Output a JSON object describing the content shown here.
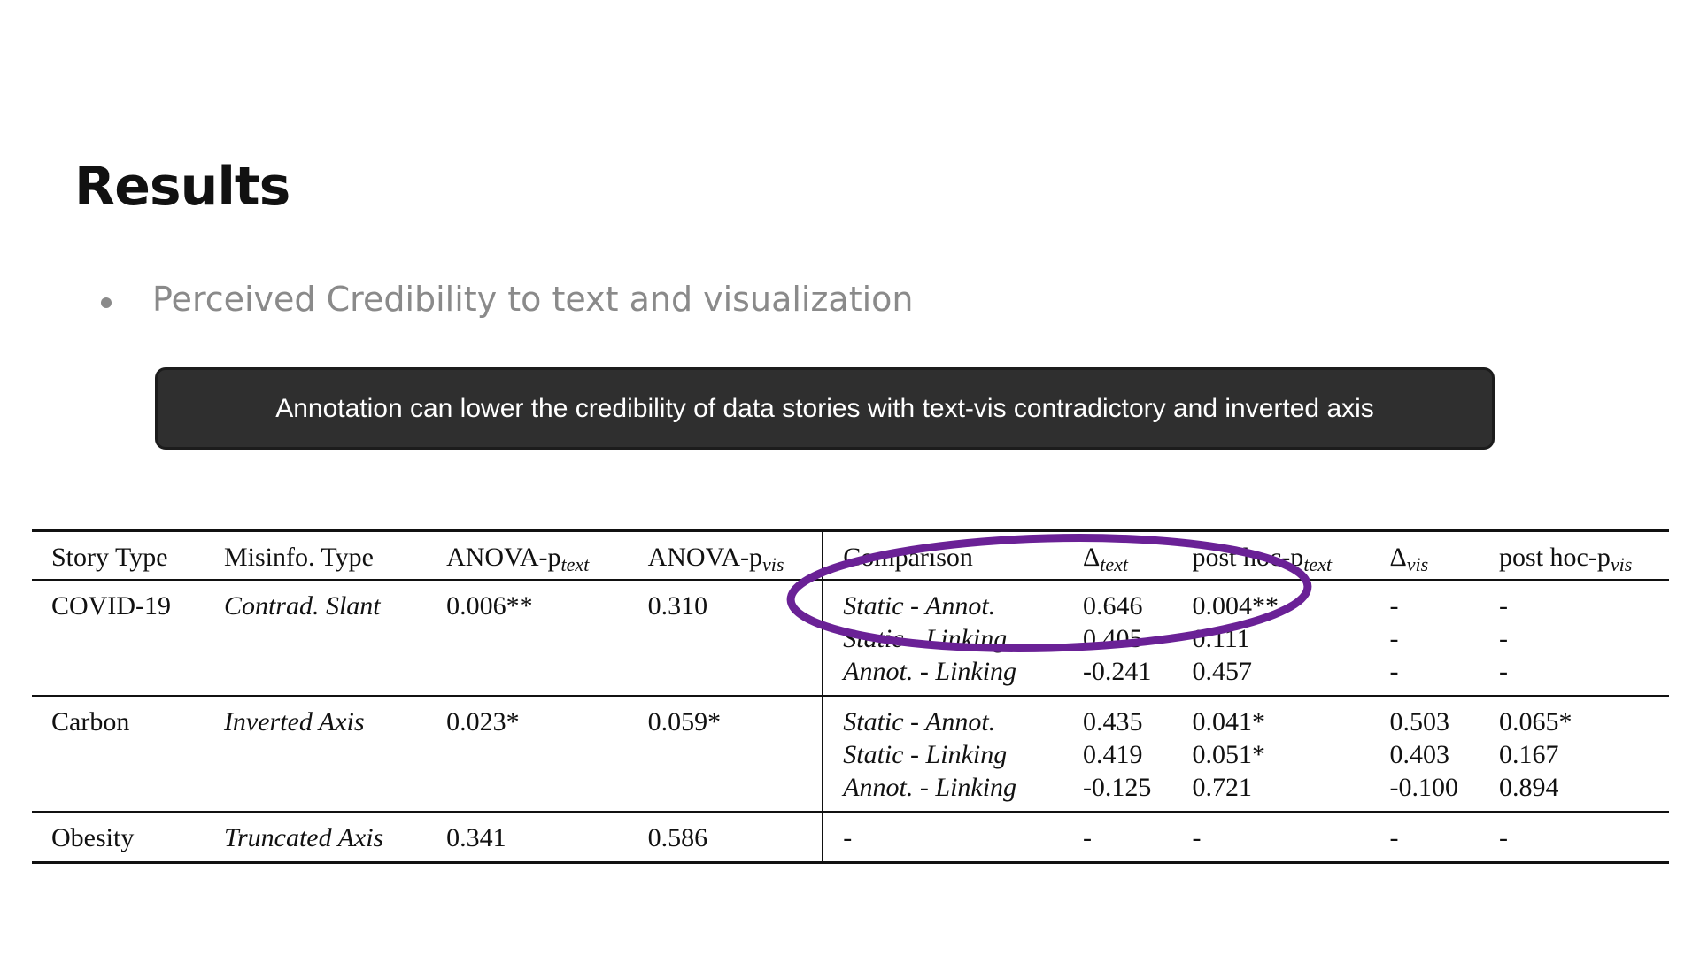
{
  "slide": {
    "title": "Results",
    "bullet": "Perceived Credibility to text and visualization",
    "callout": "Annotation can lower the credibility of data stories with text-vis contradictory and inverted axis"
  },
  "table": {
    "headers": {
      "story_type": "Story Type",
      "misinfo_type": "Misinfo. Type",
      "anova_text": {
        "base": "ANOVA-p",
        "sub": "text"
      },
      "anova_vis": {
        "base": "ANOVA-p",
        "sub": "vis"
      },
      "comparison": "Comparison",
      "delta_text": {
        "base": "Δ",
        "sub": "text"
      },
      "posthoc_text": {
        "base": "post hoc-p",
        "sub": "text"
      },
      "delta_vis": {
        "base": "Δ",
        "sub": "vis"
      },
      "posthoc_vis": {
        "base": "post hoc-p",
        "sub": "vis"
      }
    },
    "groups": [
      {
        "story_type": "COVID-19",
        "misinfo_type": "Contrad. Slant",
        "anova_text": "0.006**",
        "anova_vis": "0.310",
        "rows": [
          {
            "comparison": "Static - Annot.",
            "delta_text": "0.646",
            "posthoc_text": "0.004**",
            "delta_vis": "-",
            "posthoc_vis": "-"
          },
          {
            "comparison": "Static - Linking",
            "delta_text": "0.405",
            "posthoc_text": "0.111",
            "delta_vis": "-",
            "posthoc_vis": "-"
          },
          {
            "comparison": "Annot. - Linking",
            "delta_text": "-0.241",
            "posthoc_text": "0.457",
            "delta_vis": "-",
            "posthoc_vis": "-"
          }
        ]
      },
      {
        "story_type": "Carbon",
        "misinfo_type": "Inverted Axis",
        "anova_text": "0.023*",
        "anova_vis": "0.059*",
        "rows": [
          {
            "comparison": "Static - Annot.",
            "delta_text": "0.435",
            "posthoc_text": "0.041*",
            "delta_vis": "0.503",
            "posthoc_vis": "0.065*"
          },
          {
            "comparison": "Static - Linking",
            "delta_text": "0.419",
            "posthoc_text": "0.051*",
            "delta_vis": "0.403",
            "posthoc_vis": "0.167"
          },
          {
            "comparison": "Annot. - Linking",
            "delta_text": "-0.125",
            "posthoc_text": "0.721",
            "delta_vis": "-0.100",
            "posthoc_vis": "0.894"
          }
        ]
      },
      {
        "story_type": "Obesity",
        "misinfo_type": "Truncated Axis",
        "anova_text": "0.341",
        "anova_vis": "0.586",
        "rows": [
          {
            "comparison": "-",
            "delta_text": "-",
            "posthoc_text": "-",
            "delta_vis": "-",
            "posthoc_vis": "-"
          }
        ]
      }
    ]
  },
  "colors": {
    "callout_bg": "#2f2f2f",
    "highlight_ellipse": "#6a2196",
    "bullet_text": "#8a8a8a"
  }
}
